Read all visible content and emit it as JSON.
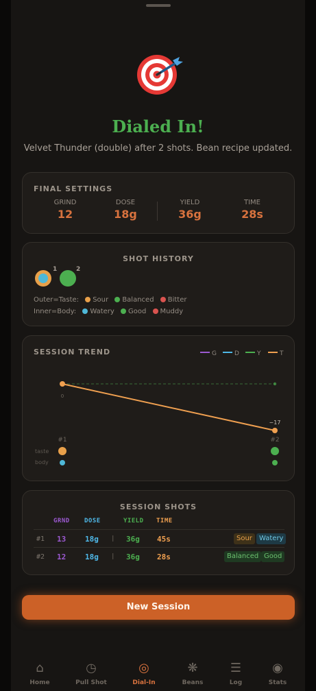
{
  "hero": {
    "title": "Dialed In!",
    "subtitle": "Velvet Thunder (double) after 2 shots. Bean recipe updated."
  },
  "final_settings": {
    "label": "FINAL SETTINGS",
    "items": [
      {
        "key": "GRIND",
        "value": "12"
      },
      {
        "key": "DOSE",
        "value": "18g"
      },
      {
        "key": "YIELD",
        "value": "36g"
      },
      {
        "key": "TIME",
        "value": "28s"
      }
    ]
  },
  "shot_history": {
    "label": "SHOT HISTORY",
    "dots": [
      {
        "num": "1",
        "outer_color": "#e8a04a",
        "inner_color": "#4fb8d8"
      },
      {
        "num": "2",
        "outer_color": "#4caf50",
        "inner_color": "#4caf50"
      }
    ],
    "outer_legend": {
      "label": "Outer=Taste:",
      "items": [
        {
          "name": "Sour",
          "color": "#e8a04a"
        },
        {
          "name": "Balanced",
          "color": "#4caf50"
        },
        {
          "name": "Bitter",
          "color": "#d9534f"
        }
      ]
    },
    "inner_legend": {
      "label": "Inner=Body:",
      "items": [
        {
          "name": "Watery",
          "color": "#4fb8d8"
        },
        {
          "name": "Good",
          "color": "#4caf50"
        },
        {
          "name": "Muddy",
          "color": "#d9534f"
        }
      ]
    }
  },
  "session_trend": {
    "label": "SESSION TREND",
    "legend": [
      {
        "name": "G",
        "color": "#9b59d0"
      },
      {
        "name": "D",
        "color": "#4fb8e8"
      },
      {
        "name": "Y",
        "color": "#4caf50"
      },
      {
        "name": "T",
        "color": "#f0a050"
      }
    ],
    "start_label": "0",
    "end_label": "−17",
    "row_labels": {
      "taste": "taste",
      "body": "body"
    },
    "shots": [
      {
        "id": "#1",
        "taste_color": "#e8a04a",
        "body_color": "#4fb8d8"
      },
      {
        "id": "#2",
        "taste_color": "#4caf50",
        "body_color": "#4caf50"
      }
    ]
  },
  "chart_data": {
    "type": "line",
    "x": [
      "#1",
      "#2"
    ],
    "series": [
      {
        "name": "T",
        "color": "#f0a050",
        "values": [
          0,
          -17
        ]
      },
      {
        "name": "Y",
        "color": "#4caf50",
        "values": [
          0,
          0
        ]
      }
    ],
    "ylim": [
      -20,
      10
    ],
    "grid": false,
    "legend": "top-right"
  },
  "session_shots": {
    "label": "SESSION SHOTS",
    "headers": [
      "GRND",
      "DOSE",
      "YIELD",
      "TIME"
    ],
    "header_colors": [
      "#9b59d0",
      "#4fb8e8",
      "#4caf50",
      "#f0a050"
    ],
    "separator": "|",
    "rows": [
      {
        "id": "#1",
        "grind": "13",
        "dose": "18g",
        "yield": "36g",
        "time": "45s",
        "taste": "Sour",
        "body": "Watery"
      },
      {
        "id": "#2",
        "grind": "12",
        "dose": "18g",
        "yield": "36g",
        "time": "28s",
        "taste": "Balanced",
        "body": "Good"
      }
    ]
  },
  "actions": {
    "new_session": "New Session"
  },
  "nav": [
    {
      "label": "Home",
      "icon": "home-icon",
      "glyph": "⌂",
      "active": false
    },
    {
      "label": "Pull Shot",
      "icon": "timer-icon",
      "glyph": "◷",
      "active": false
    },
    {
      "label": "Dial-In",
      "icon": "target-icon",
      "glyph": "◎",
      "active": true
    },
    {
      "label": "Beans",
      "icon": "bean-icon",
      "glyph": "❋",
      "active": false
    },
    {
      "label": "Log",
      "icon": "list-icon",
      "glyph": "☰",
      "active": false
    },
    {
      "label": "Stats",
      "icon": "stats-icon",
      "glyph": "◉",
      "active": false
    }
  ]
}
